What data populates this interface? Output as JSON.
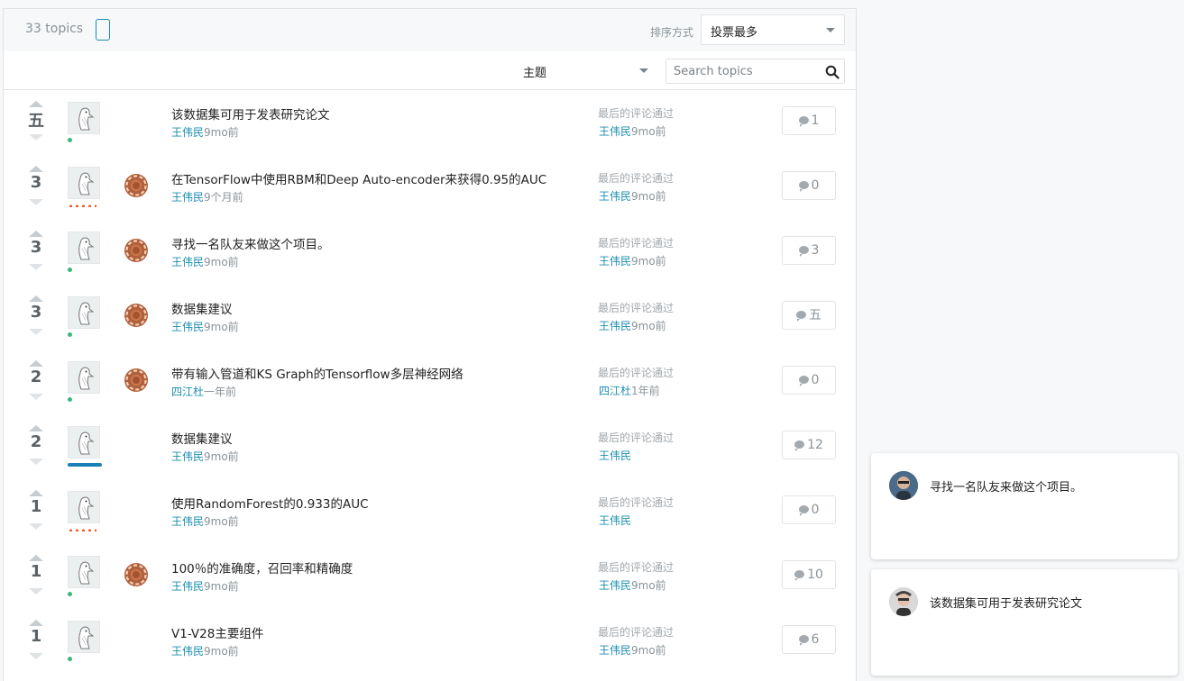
{
  "header": {
    "topics_count": "33 topics",
    "sort_label": "排序方式",
    "sort_value": "投票最多",
    "topic_filter": "主题",
    "search_placeholder": "Search topics"
  },
  "colors": {
    "link": "#1c8fb0",
    "online_dot": "#3fb67c",
    "orange_dots": "#f05a24",
    "blue_bar": "#1a7fb5",
    "medal_bronze": "#b0603d"
  },
  "topics": [
    {
      "votes": "五",
      "title": "该数据集可用于发表研究论文",
      "author": "王伟民",
      "time": "9mo前",
      "last_label": "最后的评论通过",
      "last_by": "王伟民",
      "last_time": "9mo前",
      "comments": "1",
      "medal": false,
      "badge": "dot"
    },
    {
      "votes": "3",
      "title": "在TensorFlow中使用RBM和Deep Auto-encoder来获得0.95的AUC",
      "author": "王伟民",
      "time": "9个月前",
      "last_label": "最后的评论通过",
      "last_by": "王伟民",
      "last_time": "9mo前",
      "comments": "0",
      "medal": true,
      "badge": "orange"
    },
    {
      "votes": "3",
      "title": "寻找一名队友来做这个项目。",
      "author": "王伟民",
      "time": "9mo前",
      "last_label": "最后的评论通过",
      "last_by": "王伟民",
      "last_time": "9mo前",
      "comments": "3",
      "medal": true,
      "badge": "dot"
    },
    {
      "votes": "3",
      "title": "数据集建议",
      "author": "王伟民",
      "time": "9mo前",
      "last_label": "最后的评论通过",
      "last_by": "王伟民",
      "last_time": "9mo前",
      "comments": "五",
      "medal": true,
      "badge": "dot"
    },
    {
      "votes": "2",
      "title": "带有输入管道和KS Graph的Tensorflow多层神经网络",
      "author": "四江杜",
      "time": "一年前",
      "last_label": "最后的评论通过",
      "last_by": "四江杜",
      "last_time": "1年前",
      "comments": "0",
      "medal": true,
      "badge": "dot"
    },
    {
      "votes": "2",
      "title": "数据集建议",
      "author": "王伟民",
      "time": "9mo前",
      "last_label": "最后的评论通过",
      "last_by": "王伟民",
      "last_time": "",
      "comments": "12",
      "medal": false,
      "badge": "blue"
    },
    {
      "votes": "1",
      "title": "使用RandomForest的0.933的AUC",
      "author": "王伟民",
      "time": "9mo前",
      "last_label": "最后的评论通过",
      "last_by": "王伟民",
      "last_time": "",
      "comments": "0",
      "medal": false,
      "badge": "orange"
    },
    {
      "votes": "1",
      "title": "100％的准确度，召回率和精确度",
      "author": "王伟民",
      "time": "9mo前",
      "last_label": "最后的评论通过",
      "last_by": "王伟民",
      "last_time": "9mo前",
      "comments": "10",
      "medal": true,
      "badge": "dot"
    },
    {
      "votes": "1",
      "title": "V1-V28主要组件",
      "author": "王伟民",
      "time": "9mo前",
      "last_label": "最后的评论通过",
      "last_by": "王伟民",
      "last_time": "9mo前",
      "comments": "6",
      "medal": false,
      "badge": "dot"
    }
  ],
  "cards": [
    {
      "text": "寻找一名队友来做这个项目。"
    },
    {
      "text": "该数据集可用于发表研究论文"
    }
  ]
}
